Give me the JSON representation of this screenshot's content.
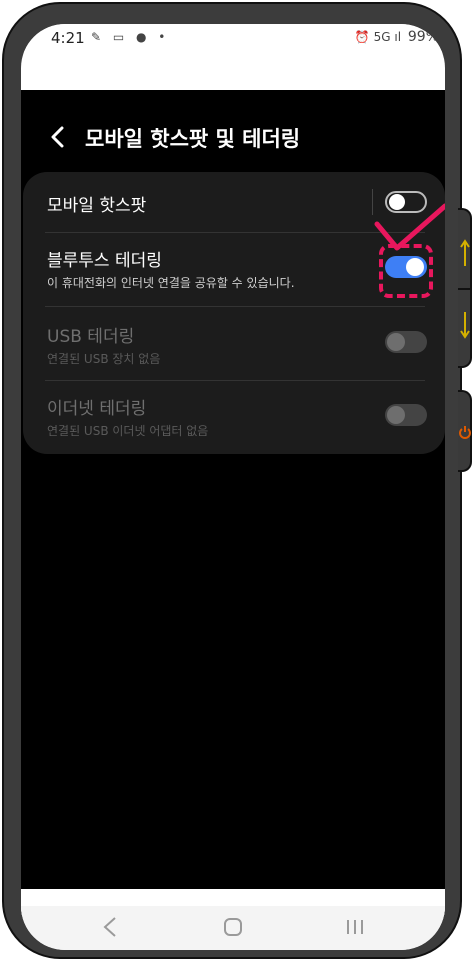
{
  "status_bar": {
    "time": "4:21",
    "left_icons": [
      "wifi-calling-icon",
      "card-icon",
      "talk-icon",
      "dot"
    ],
    "left_icons_text": "✎ ▭ ● •",
    "right_icons_text": "⏰ 5G ıl 99%",
    "battery": "99%"
  },
  "header": {
    "title": "모바일 핫스팟 및 테더링",
    "back_icon": "back-chevron-icon"
  },
  "settings": {
    "hotspot": {
      "title": "모바일 핫스팟",
      "enabled": false
    },
    "bluetooth": {
      "title": "블루투스 테더링",
      "subtitle": "이 휴대전화의 인터넷 연결을 공유할 수 있습니다.",
      "enabled": true
    },
    "usb": {
      "title": "USB 테더링",
      "subtitle": "연결된 USB 장치 없음",
      "enabled": false,
      "disabled": true
    },
    "ethernet": {
      "title": "이더넷 테더링",
      "subtitle": "연결된 USB 이더넷 어댑터 없음",
      "enabled": false,
      "disabled": true
    }
  },
  "colors": {
    "background": "#000000",
    "card": "#1c1c1c",
    "toggle_on": "#3e7ff5",
    "annotation": "#e8175d",
    "volume_arrows": "#d4b000",
    "power_icon": "#e05a00"
  },
  "navbar": {
    "back": "nav-back-icon",
    "home": "nav-home-icon",
    "recents": "nav-recents-icon"
  },
  "side_buttons": {
    "volume_up": "arrow-up-icon",
    "volume_down": "arrow-down-icon",
    "power": "power-icon"
  }
}
